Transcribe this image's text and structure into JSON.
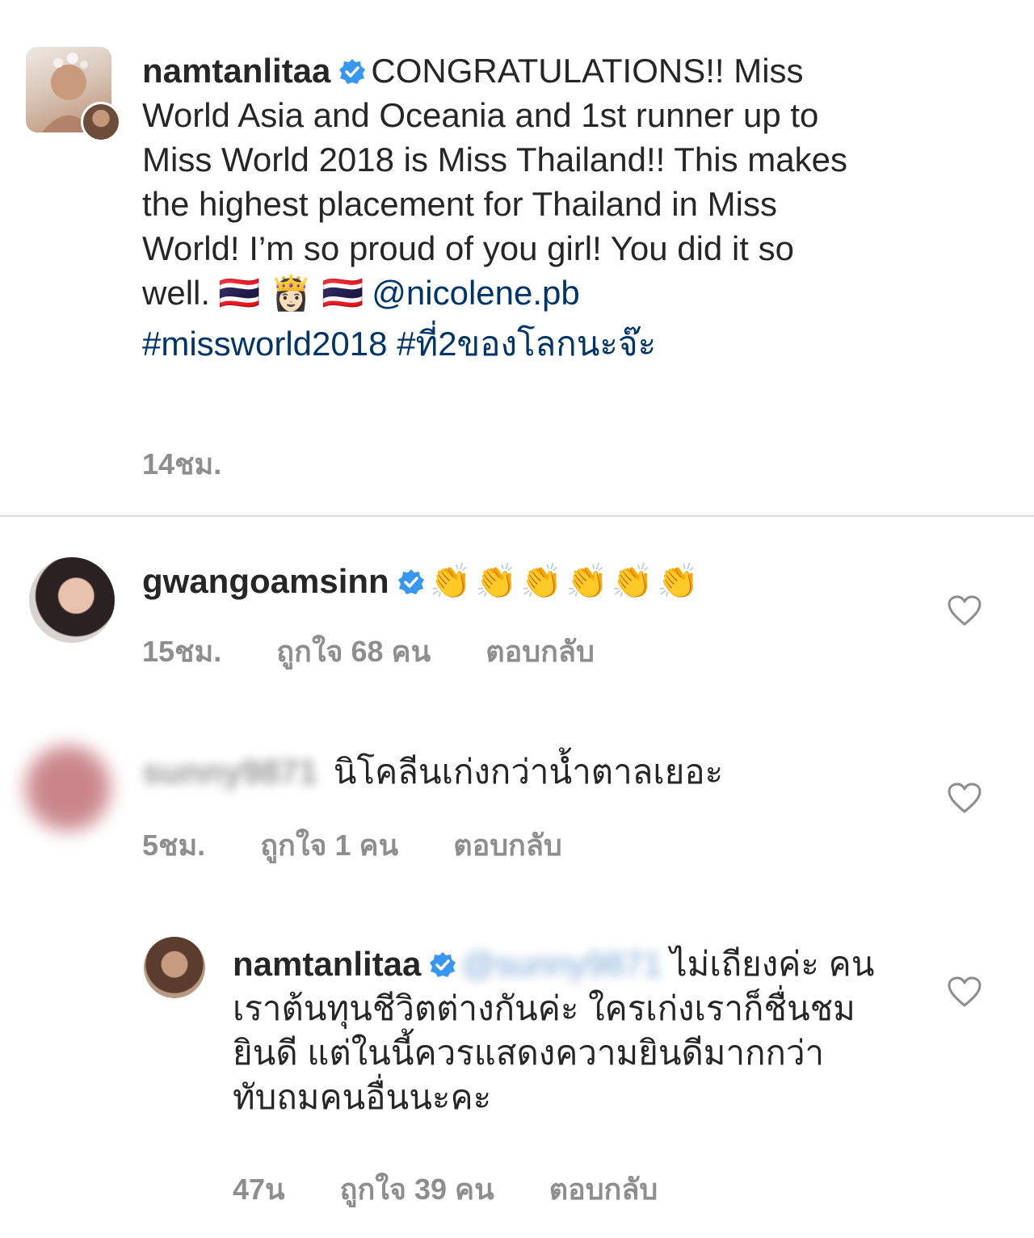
{
  "caption": {
    "username": "namtanlitaa",
    "text": "CONGRATULATIONS!! Miss World Asia and Oceania and 1st runner up to Miss World 2018 is Miss Thailand!! This makes the highest placement for Thailand in Miss World! I’m so proud of you girl! You did it so well.",
    "emojis": "🇹🇭 👸🏻 🇹🇭",
    "mention": "@nicolene.pb",
    "hashtags": "#missworld2018 #ที่2ของโลกนะจ๊ะ",
    "time": "14ชม."
  },
  "comments": [
    {
      "username": "gwangoamsinn",
      "text": "👏👏👏👏👏👏",
      "time": "15ชม.",
      "likes": "ถูกใจ 68 คน",
      "reply": "ตอบกลับ"
    },
    {
      "username": "sunny9871",
      "text": "นิโคลีนเก่งกว่าน้ำตาลเยอะ",
      "time": "5ชม.",
      "likes": "ถูกใจ 1 คน",
      "reply": "ตอบกลับ"
    },
    {
      "username": "namtanlitaa",
      "mention": "@sunny9871",
      "text": "ไม่เถียงค่ะ คนเราต้นทุนชีวิตต่างกันค่ะ ใครเก่งเราก็ชื่นชมยินดี แต่ในนี้ควรแสดงความยินดีมากกว่าทับถมคนอื่นนะคะ",
      "time": "47น",
      "likes": "ถูกใจ 39 คน",
      "reply": "ตอบกลับ"
    }
  ],
  "colors": {
    "text": "#262626",
    "meta": "#8e8e8e",
    "link": "#003569",
    "verified": "#3897f0",
    "divider": "#dbdbdb"
  }
}
